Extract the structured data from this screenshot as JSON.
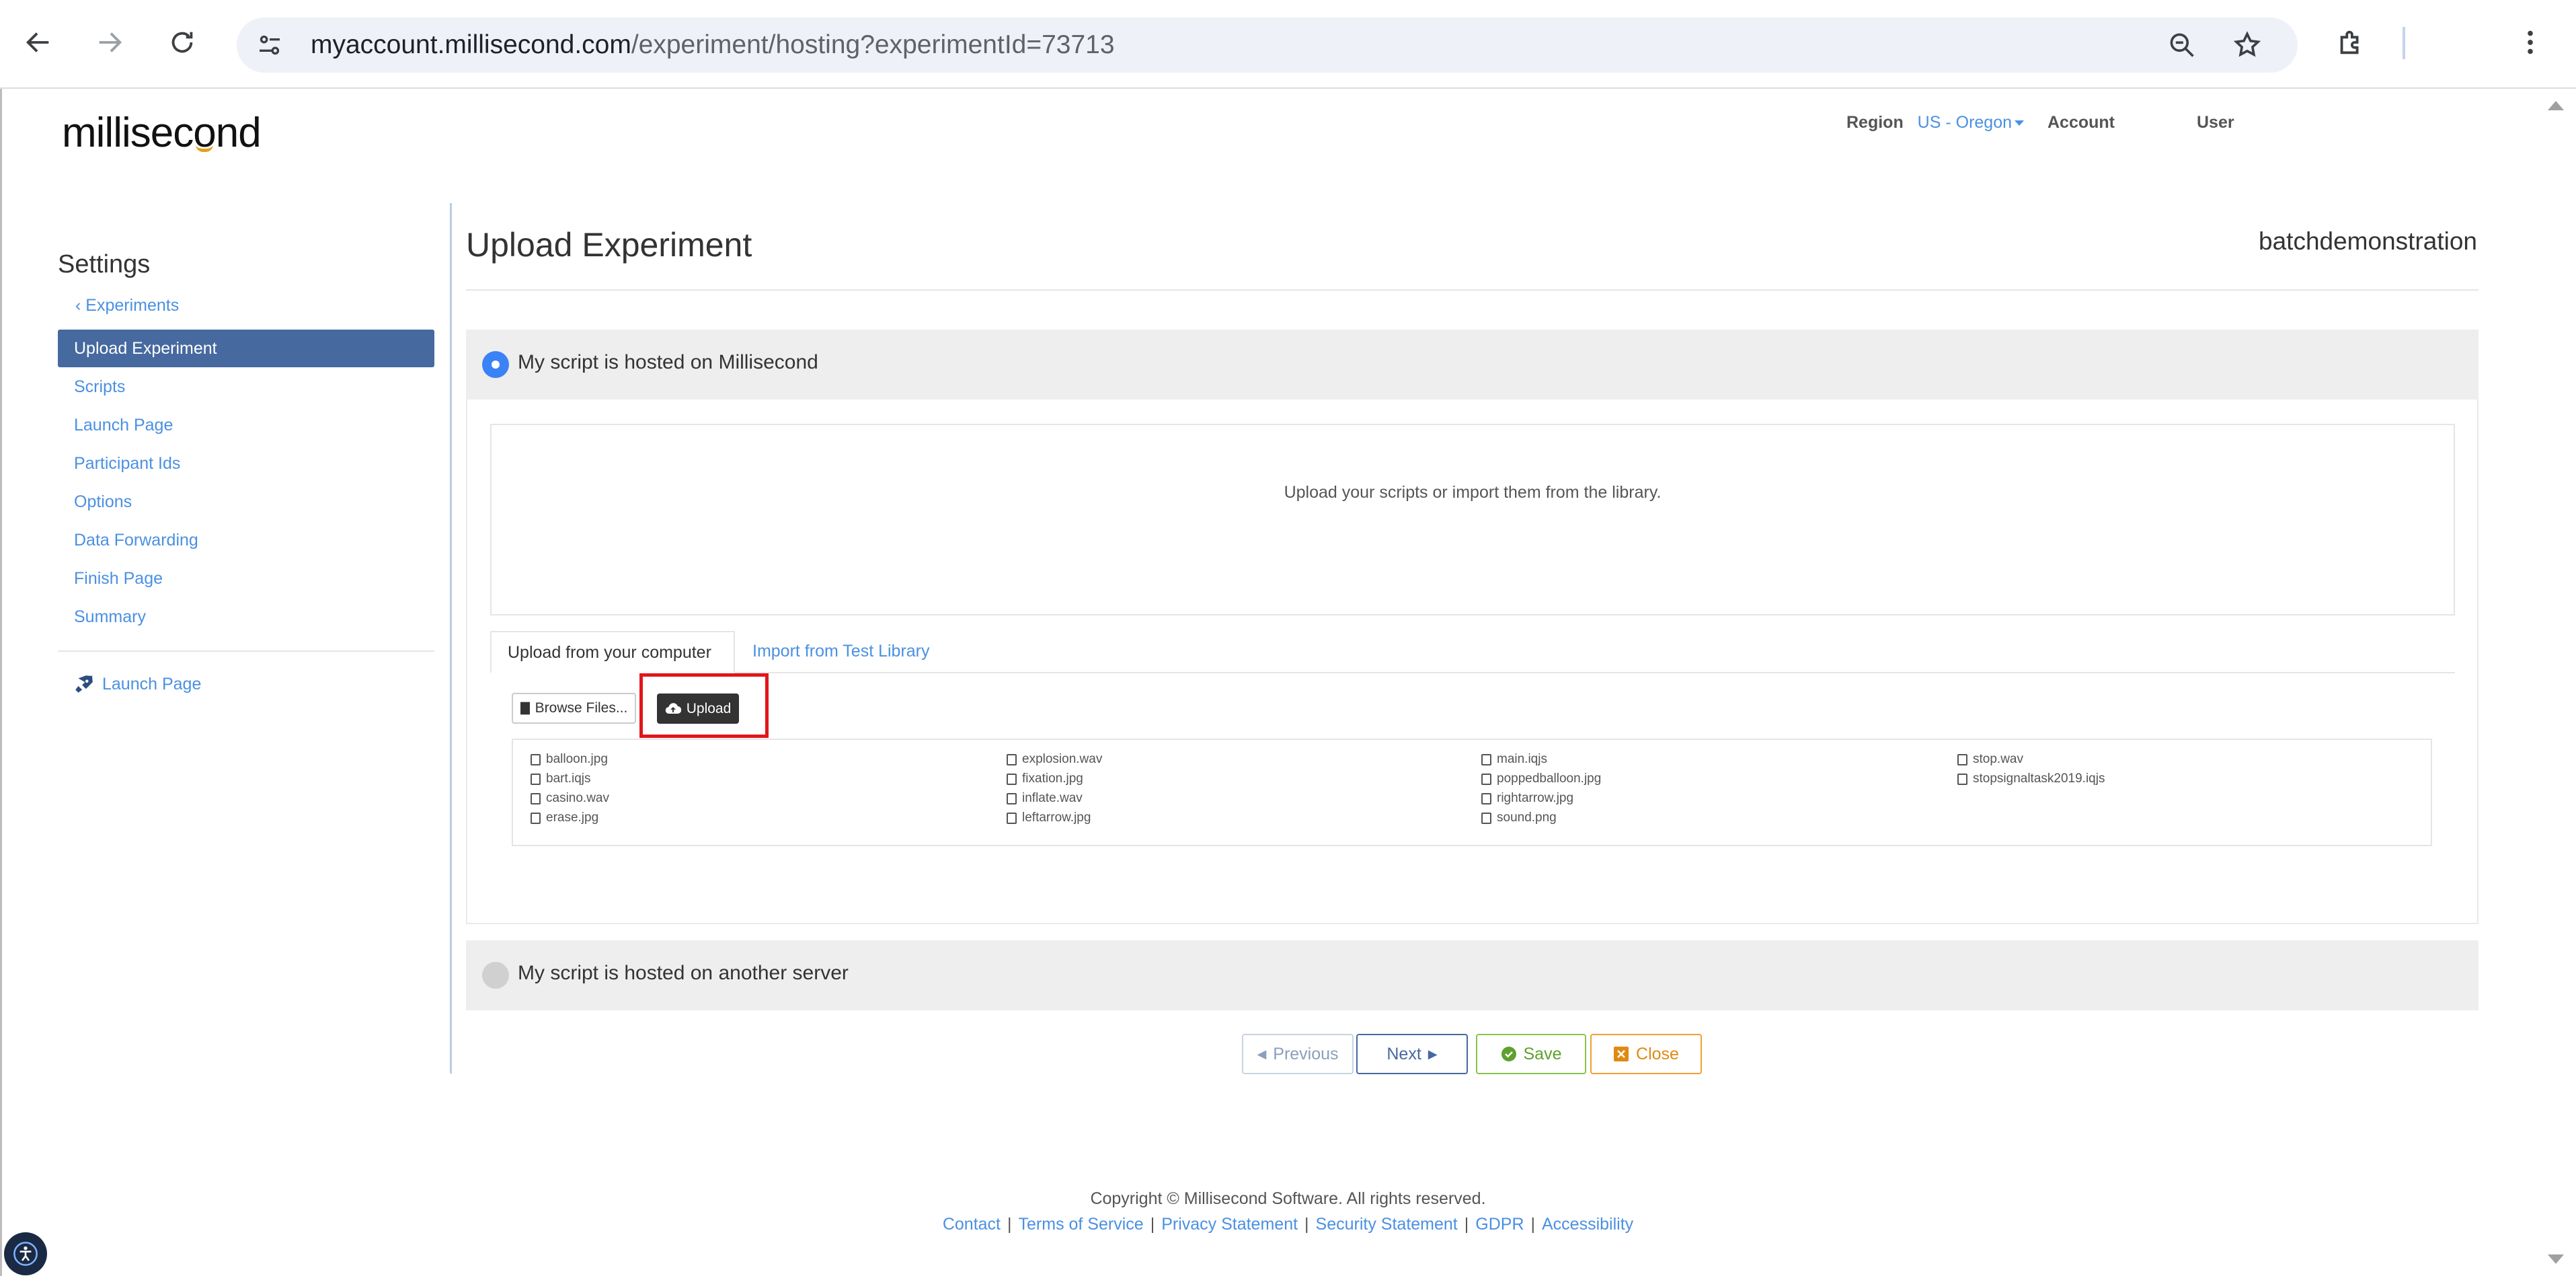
{
  "browser": {
    "url_host": "myaccount.millisecond.com",
    "url_path": "/experiment/hosting?experimentId=73713",
    "icons": [
      "back-icon",
      "forward-icon",
      "reload-icon",
      "site-info-icon",
      "zoom-out-icon",
      "star-icon",
      "extensions-icon",
      "more-icon"
    ]
  },
  "header": {
    "logo": "millisecond",
    "region_label": "Region",
    "region_value": "US - Oregon",
    "account_label": "Account",
    "user_label": "User"
  },
  "sidebar": {
    "title": "Settings",
    "back_link": "Experiments",
    "items": [
      {
        "label": "Upload Experiment",
        "active": true
      },
      {
        "label": "Scripts"
      },
      {
        "label": "Launch Page"
      },
      {
        "label": "Participant Ids"
      },
      {
        "label": "Options"
      },
      {
        "label": "Data Forwarding"
      },
      {
        "label": "Finish Page"
      },
      {
        "label": "Summary"
      }
    ],
    "launch_link": "Launch Page"
  },
  "main": {
    "title": "Upload Experiment",
    "experiment_name": "batchdemonstration",
    "option_hosted_millisecond": "My script is hosted on Millisecond",
    "option_hosted_other": "My script is hosted on another server",
    "dropzone_text": "Upload your scripts or import them from the library.",
    "tabs": [
      {
        "label": "Upload from your computer",
        "active": true
      },
      {
        "label": "Import from Test Library"
      }
    ],
    "browse_label": "Browse Files...",
    "upload_label": "Upload",
    "files": [
      [
        "balloon.jpg",
        "bart.iqjs",
        "casino.wav",
        "erase.jpg"
      ],
      [
        "explosion.wav",
        "fixation.jpg",
        "inflate.wav",
        "leftarrow.jpg"
      ],
      [
        "main.iqjs",
        "poppedballoon.jpg",
        "rightarrow.jpg",
        "sound.png"
      ],
      [
        "stop.wav",
        "stopsignaltask2019.iqjs"
      ]
    ]
  },
  "actions": {
    "previous": "Previous",
    "next": "Next",
    "save": "Save",
    "close": "Close"
  },
  "footer": {
    "copyright": "Copyright © Millisecond Software. All rights reserved.",
    "links": [
      "Contact",
      "Terms of Service",
      "Privacy Statement",
      "Security Statement",
      "GDPR",
      "Accessibility"
    ],
    "separator": "|"
  },
  "colors": {
    "accent": "#4a90e2",
    "sidebar_active": "#46699f",
    "highlight": "#e0161b",
    "save": "#5fa02f",
    "close": "#e08a12"
  }
}
